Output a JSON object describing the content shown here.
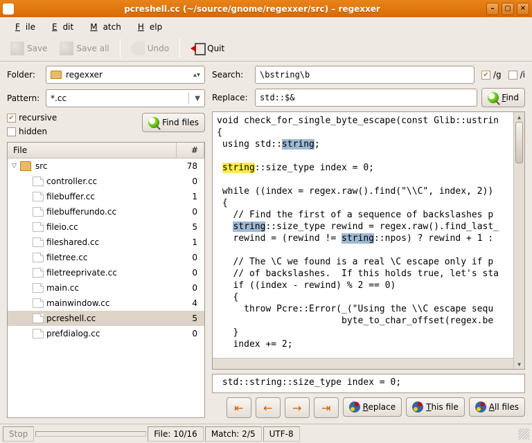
{
  "window": {
    "title": "pcreshell.cc (~/source/gnome/regexxer/src) – regexxer"
  },
  "menu": {
    "file": "File",
    "edit": "Edit",
    "match": "Match",
    "help": "Help"
  },
  "toolbar": {
    "save": "Save",
    "saveall": "Save all",
    "undo": "Undo",
    "quit": "Quit"
  },
  "left": {
    "folder_label": "Folder:",
    "folder_value": "regexxer",
    "pattern_label": "Pattern:",
    "pattern_value": "*.cc",
    "recursive": "recursive",
    "hidden": "hidden",
    "findfiles": "Find files",
    "col_file": "File",
    "col_count": "#",
    "root": {
      "name": "src",
      "count": 78
    },
    "files": [
      {
        "name": "controller.cc",
        "count": 0
      },
      {
        "name": "filebuffer.cc",
        "count": 1
      },
      {
        "name": "filebufferundo.cc",
        "count": 0
      },
      {
        "name": "fileio.cc",
        "count": 5
      },
      {
        "name": "fileshared.cc",
        "count": 1
      },
      {
        "name": "filetree.cc",
        "count": 0
      },
      {
        "name": "filetreeprivate.cc",
        "count": 0
      },
      {
        "name": "main.cc",
        "count": 0
      },
      {
        "name": "mainwindow.cc",
        "count": 4
      },
      {
        "name": "pcreshell.cc",
        "count": 5,
        "selected": true
      },
      {
        "name": "prefdialog.cc",
        "count": 0
      }
    ]
  },
  "right": {
    "search_label": "Search:",
    "search_value": "\\bstring\\b",
    "g_flag": "/g",
    "i_flag": "/i",
    "replace_label": "Replace:",
    "replace_value": "std::$&",
    "find_btn": "Find",
    "preview": " std::string::size_type index = 0;",
    "replace_btn": "Replace",
    "thisfile_btn": "This file",
    "allfiles_btn": "All files"
  },
  "status": {
    "stop": "Stop",
    "file": "File: 10/16",
    "match": "Match: 2/5",
    "encoding": "UTF-8"
  }
}
